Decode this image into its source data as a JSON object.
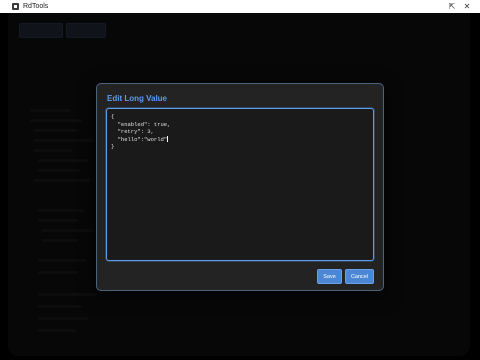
{
  "window": {
    "title": "RdTools",
    "pin_icon": "pin-icon",
    "close_icon": "close-icon"
  },
  "background": {
    "buttons": [
      "",
      ""
    ]
  },
  "dialog": {
    "title": "Edit Long Value",
    "code_lines": [
      "{",
      "  \"enabled\": true,",
      "  \"retry\": 3,",
      "  \"hello\":\"world\"",
      "}"
    ],
    "save_label": "Save",
    "cancel_label": "Cancel"
  }
}
